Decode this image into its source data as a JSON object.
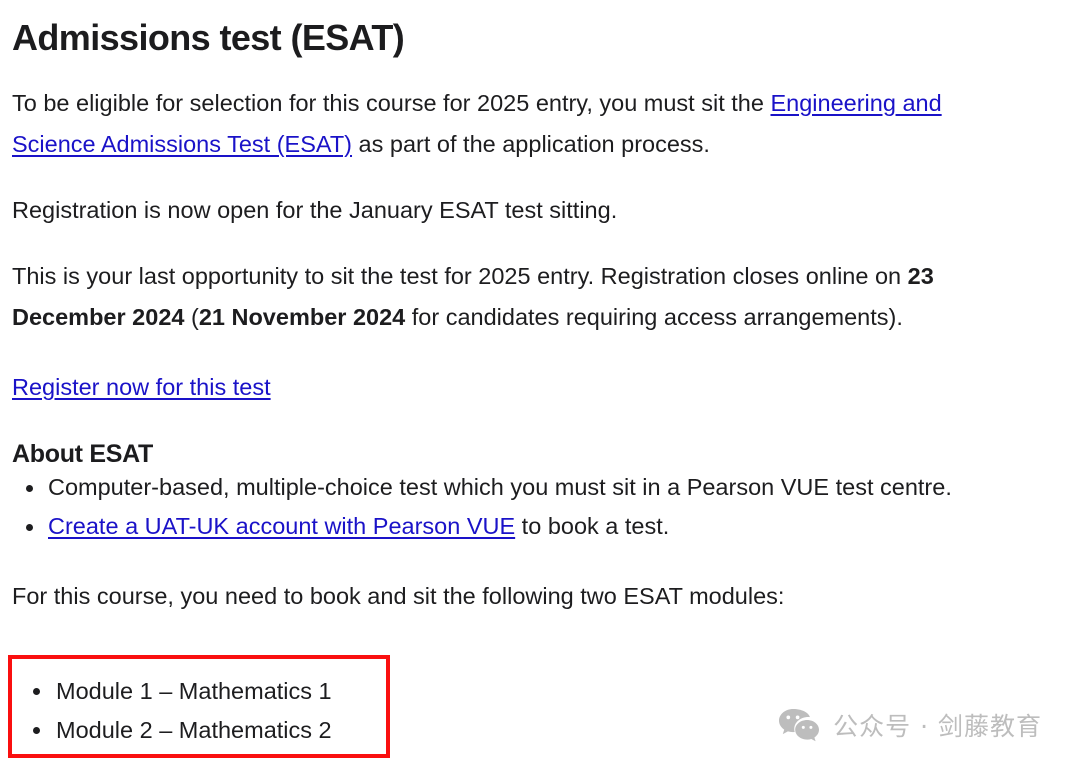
{
  "page": {
    "title": "Admissions test (ESAT)"
  },
  "intro": {
    "before_link": "To be eligible for selection for this course for 2025 entry, you must sit the ",
    "link_text": "Engineering and Science Admissions Test (ESAT)",
    "after_link": " as part of the application process."
  },
  "registration": {
    "open_text": "Registration is now open for the January ESAT test sitting.",
    "last_chance_part1": "This is your last opportunity to sit the test for 2025 entry. Registration closes online on ",
    "deadline_main": "23 December 2024",
    "bracket_open": " (",
    "deadline_access": "21 November 2024",
    "last_chance_part2": " for candidates requiring access arrangements).",
    "register_link": "Register now for this test"
  },
  "about": {
    "heading": "About ESAT",
    "bullets": [
      {
        "text": "Computer-based, multiple-choice test which you must sit in a Pearson VUE test centre.",
        "link_text": "",
        "after_link": ""
      },
      {
        "text": "",
        "link_text": "Create a UAT-UK account with Pearson VUE",
        "after_link": " to book a test."
      }
    ],
    "bullet_1_text": "Computer-based, multiple-choice test which you must sit in a Pearson VUE test centre.",
    "bullet_2_link": "Create a UAT-UK account with Pearson VUE",
    "bullet_2_after": " to book a test."
  },
  "modules": {
    "intro": "For this course, you need to book and sit the following two ESAT modules:",
    "items": [
      "Module 1 – Mathematics 1",
      "Module 2 – Mathematics 2"
    ],
    "highlight_color": "#fa0f0f"
  },
  "watermark": {
    "icon": "wechat-icon",
    "text": "公众号 · 剑藤教育",
    "color": "#bdbdbd"
  },
  "colors": {
    "link": "#1a12c8",
    "text": "#1d1d1f",
    "heading": "#1c1c1e",
    "background": "#ffffff"
  }
}
